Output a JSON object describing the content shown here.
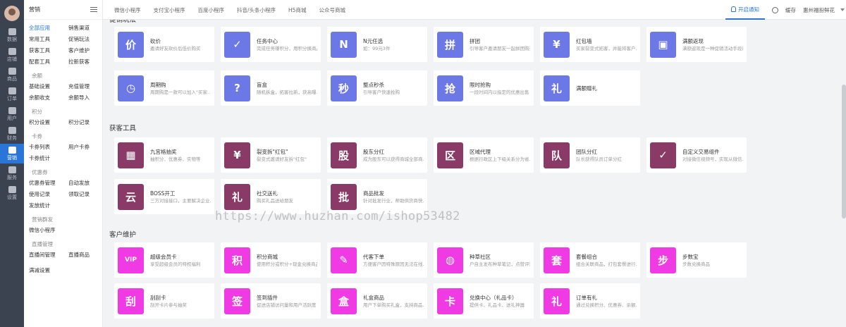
{
  "rail": {
    "items": [
      {
        "label": "数据",
        "icon": "chart-icon"
      },
      {
        "label": "店铺",
        "icon": "store-icon"
      },
      {
        "label": "商品",
        "icon": "goods-icon"
      },
      {
        "label": "订单",
        "icon": "order-icon"
      },
      {
        "label": "用户",
        "icon": "user-icon"
      },
      {
        "label": "财务",
        "icon": "finance-icon"
      },
      {
        "label": "营销",
        "icon": "marketing-icon",
        "active": true
      },
      {
        "label": "服务",
        "icon": "service-icon"
      },
      {
        "label": "设置",
        "icon": "settings-icon"
      }
    ]
  },
  "sidebar": {
    "title": "营销",
    "groups": [
      {
        "title": "",
        "links": [
          "全部应用",
          "销售渠道",
          "常用工具",
          "促销玩法",
          "获客工具",
          "客户维护",
          "配套工具",
          "拉新获客"
        ]
      },
      {
        "title": "余额",
        "links": [
          "基础设置",
          "充值管理",
          "余额收支",
          "余额导入"
        ]
      },
      {
        "title": "积分",
        "links": [
          "积分设置",
          "积分记录"
        ]
      },
      {
        "title": "卡券",
        "links": [
          "卡券列表",
          "用户卡券",
          "卡券统计"
        ]
      },
      {
        "title": "优惠券",
        "links": [
          "优惠券管理",
          "自动发放",
          "使用记录",
          "领取记录",
          "发放统计"
        ]
      },
      {
        "title": "营销群发",
        "links": [
          "微信小程序"
        ]
      },
      {
        "title": "直播管理",
        "links": [
          "直播间管理",
          "直播商品"
        ]
      },
      {
        "title": "",
        "links": [
          "满减设置"
        ]
      }
    ]
  },
  "topbar": {
    "tabs": [
      "微信小程序",
      "支付宝小程序",
      "百度小程序",
      "抖音/头条小程序",
      "H5商城",
      "公众号商城"
    ],
    "notify": "开启通知",
    "cache": "缓存",
    "store": "惠州福扮鲜花"
  },
  "sections": [
    {
      "title": "促销玩法",
      "color": "#6b78e6",
      "items": [
        {
          "name": "砍价",
          "desc": "邀请好友砍价后低价购买",
          "glyph": "价"
        },
        {
          "name": "任务中心",
          "desc": "完成任务赚积分，用积分换商品",
          "glyph": "✓"
        },
        {
          "name": "N元任选",
          "desc": "如：99元3件",
          "glyph": "N"
        },
        {
          "name": "拼团",
          "desc": "引导客户邀请朋友一起拼团购买",
          "glyph": "拼"
        },
        {
          "name": "红包墙",
          "desc": "买家裂变式拓客，并能将客户…",
          "glyph": "¥"
        },
        {
          "name": "满额返现",
          "desc": "满额返现是一种促销活动手段的玩…",
          "glyph": "▣"
        },
        {
          "name": "周期购",
          "desc": "周期购是一款可以加入\"买家…",
          "glyph": "◷"
        },
        {
          "name": "盲盒",
          "desc": "随机拆盒，拓客拉新，获高曝…",
          "glyph": "?"
        },
        {
          "name": "整点秒杀",
          "desc": "引导客户快速抢购",
          "glyph": "秒"
        },
        {
          "name": "限时抢购",
          "desc": "一段时间内以指定的优惠出售",
          "glyph": "抢"
        },
        {
          "name": "满额赠礼",
          "desc": "",
          "glyph": "礼"
        }
      ]
    },
    {
      "title": "获客工具",
      "color": "#8a3a66",
      "items": [
        {
          "name": "九宫格抽奖",
          "desc": "抽积分、优惠券、实物等",
          "glyph": "▦"
        },
        {
          "name": "裂变拆\"红包\"",
          "desc": "裂变式邀请好友拆\"红包\"",
          "glyph": "¥"
        },
        {
          "name": "股东分红",
          "desc": "成为股东可以获得商城全部商…",
          "glyph": "股"
        },
        {
          "name": "区域代理",
          "desc": "根据行政区上下级关系分为省…",
          "glyph": "区"
        },
        {
          "name": "团队分红",
          "desc": "队长获得队员订单分红",
          "glyph": "队"
        },
        {
          "name": "自定义交易组件",
          "desc": "对接微信视频号，实现从微信…",
          "glyph": "✓"
        },
        {
          "name": "BOSS开工",
          "desc": "三方对接接口，主要解决企业…",
          "glyph": "云"
        },
        {
          "name": "社交送礼",
          "desc": "购买礼品送给朋友",
          "glyph": "礼"
        },
        {
          "name": "商品批发",
          "desc": "针对批发行业，帮助供货商快…",
          "glyph": "批"
        }
      ]
    },
    {
      "title": "客户维护",
      "color": "#f03be4",
      "items": [
        {
          "name": "超级会员卡",
          "desc": "享受超级会员的特权福利",
          "glyph": "VIP"
        },
        {
          "name": "积分商城",
          "desc": "使用积分或积分+现金兑换商品",
          "glyph": "积"
        },
        {
          "name": "代客下单",
          "desc": "方便客户因特殊原因无法在线…",
          "glyph": "✎"
        },
        {
          "name": "种草社区",
          "desc": "户自主发布种草笔记，点赞评论…",
          "glyph": "◍"
        },
        {
          "name": "套餐组合",
          "desc": "组合关联商品，打包套餐进行…",
          "glyph": "套"
        },
        {
          "name": "步数宝",
          "desc": "步数兑换商品",
          "glyph": "步"
        },
        {
          "name": "刮刮卡",
          "desc": "刮开卡片参与抽奖",
          "glyph": "刮"
        },
        {
          "name": "签到插件",
          "desc": "促进店铺访问量和用户活跃度",
          "glyph": "签"
        },
        {
          "name": "礼盒商品",
          "desc": "用户下单购买礼盒，支持商品…",
          "glyph": "盒"
        },
        {
          "name": "兑换中心（礼品卡）",
          "desc": "提供卡、礼品卡、送礼神器",
          "glyph": "卡"
        },
        {
          "name": "订单有礼",
          "desc": "通过兑换积分、优惠券、余额…",
          "glyph": "礼"
        }
      ]
    }
  ],
  "watermark": "https://www.huzhan.com/ishop53482"
}
